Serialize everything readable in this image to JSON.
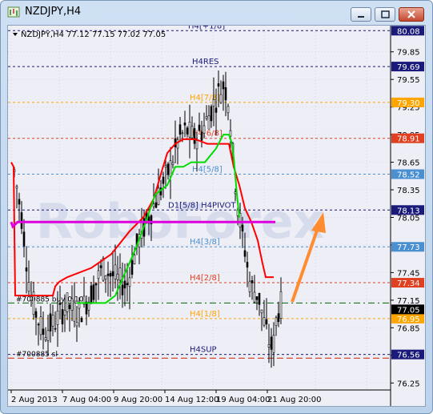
{
  "window": {
    "title": "NZDJPY,H4",
    "buttons": [
      "minimize",
      "maximize",
      "close"
    ],
    "icon": "chart-window-icon"
  },
  "chart_header": {
    "symbol_line": "NZDJPY,H4  77.12 77.15 77.02 77.05"
  },
  "watermark": "RoboForex",
  "colors": {
    "background": "#EEEEF6",
    "grid": "#C8C8DC",
    "candle": "#000000",
    "red_line": "#FF0000",
    "green_line": "#00DD00",
    "magenta_line": "#DD00DD",
    "arrow": "#FF8C30",
    "resistance_level": "#1A1A7A",
    "level_seven_eighths": "#FFA500",
    "level_six_eighths": "#E04020",
    "level_five_eighths": "#4A90D0",
    "level_three_eighths": "#4A90D0",
    "level_two_eighths": "#E04020",
    "level_one_eighth": "#FFA500",
    "current_price_bg": "#000000"
  },
  "levels": [
    {
      "label": "H4[+1/8]",
      "price": 80.08,
      "color": "#1A1A7A"
    },
    {
      "label": "H4RES",
      "price": 79.69,
      "color": "#1A1A7A"
    },
    {
      "label": "H4[7/8]",
      "price": 79.3,
      "color": "#FFA500"
    },
    {
      "label": "H4[6/8]",
      "price": 78.91,
      "color": "#E04020"
    },
    {
      "label": "H4[5/8]",
      "price": 78.52,
      "color": "#4A90D0"
    },
    {
      "label": "D1[5/8] H4PIVOT",
      "price": 78.13,
      "color": "#1A1A7A"
    },
    {
      "label": "H4[3/8]",
      "price": 77.73,
      "color": "#4A90D0"
    },
    {
      "label": "H4[2/8]",
      "price": 77.34,
      "color": "#E04020"
    },
    {
      "label": "H4[1/8]",
      "price": 76.95,
      "color": "#FFA500"
    },
    {
      "label": "H4SUP",
      "price": 76.56,
      "color": "#1A1A7A"
    }
  ],
  "order_lines": [
    {
      "label": "#700885 buy 0.10",
      "price": 77.12
    },
    {
      "label": "#700885 sl",
      "price": 76.52
    }
  ],
  "price_axis": {
    "ticks": [
      "79.85",
      "79.55",
      "79.25",
      "78.95",
      "78.65",
      "78.35",
      "78.05",
      "77.75",
      "77.45",
      "77.15",
      "76.85",
      "76.55",
      "76.25"
    ],
    "current_price": "77.05"
  },
  "time_axis": {
    "ticks": [
      "2 Aug 2013",
      "7 Aug 04:00",
      "9 Aug 20:00",
      "14 Aug 12:00",
      "19 Aug 04:00",
      "21 Aug 20:00"
    ]
  },
  "chart_data": {
    "type": "line",
    "ylim": [
      76.2,
      80.1
    ],
    "series": [
      {
        "name": "",
        "color": "#FF0000",
        "points": [
          [
            0,
            78.65
          ],
          [
            3,
            78.6
          ],
          [
            5,
            77.2
          ],
          [
            30,
            77.2
          ],
          [
            52,
            77.2
          ],
          [
            55,
            77.3
          ],
          [
            60,
            77.35
          ],
          [
            70,
            77.4
          ],
          [
            100,
            77.5
          ],
          [
            125,
            77.65
          ],
          [
            148,
            77.9
          ],
          [
            165,
            78.05
          ],
          [
            178,
            78.25
          ],
          [
            188,
            78.55
          ],
          [
            195,
            78.75
          ],
          [
            205,
            78.85
          ],
          [
            215,
            78.9
          ],
          [
            230,
            78.9
          ],
          [
            245,
            78.85
          ],
          [
            272,
            78.85
          ],
          [
            278,
            78.6
          ],
          [
            285,
            78.4
          ],
          [
            292,
            78.15
          ],
          [
            300,
            78.0
          ],
          [
            308,
            77.8
          ],
          [
            314,
            77.55
          ],
          [
            318,
            77.4
          ],
          [
            328,
            77.4
          ]
        ]
      },
      {
        "name": "",
        "color": "#00DD00",
        "points": [
          [
            82,
            77.12
          ],
          [
            118,
            77.12
          ],
          [
            130,
            77.2
          ],
          [
            155,
            77.7
          ],
          [
            168,
            78.0
          ],
          [
            180,
            78.3
          ],
          [
            195,
            78.4
          ],
          [
            205,
            78.6
          ],
          [
            215,
            78.6
          ],
          [
            225,
            78.65
          ],
          [
            242,
            78.65
          ],
          [
            256,
            78.8
          ],
          [
            265,
            78.95
          ],
          [
            272,
            78.95
          ],
          [
            276,
            78.85
          ],
          [
            278,
            78.7
          ],
          [
            282,
            78.3
          ],
          [
            285,
            78.05
          ]
        ]
      },
      {
        "name": "",
        "color": "#DD00DD",
        "points": [
          [
            0,
            78.0
          ],
          [
            2,
            77.95
          ],
          [
            8,
            78.0
          ],
          [
            330,
            78.0
          ]
        ]
      }
    ]
  }
}
